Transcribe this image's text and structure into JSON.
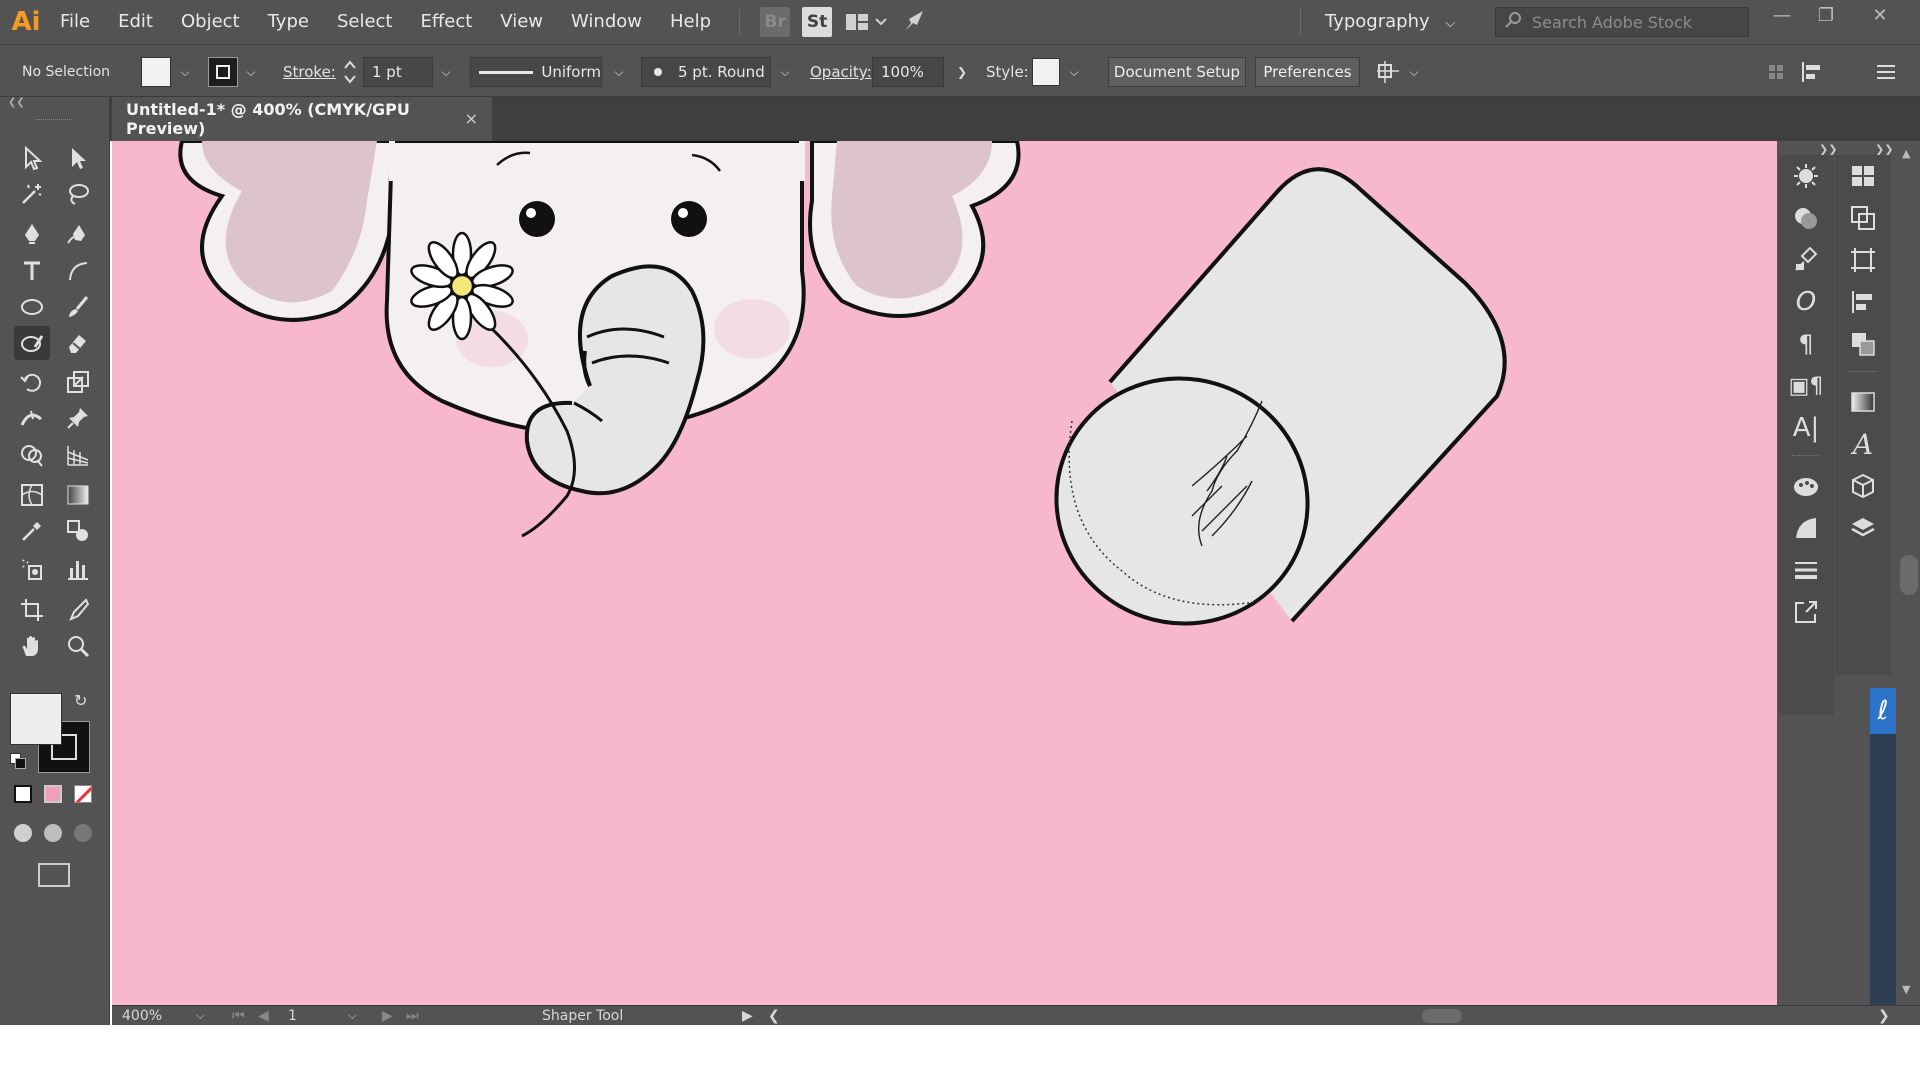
{
  "app": {
    "logo": "Ai",
    "menu": [
      "File",
      "Edit",
      "Object",
      "Type",
      "Select",
      "Effect",
      "View",
      "Window",
      "Help"
    ],
    "bridge_label": "Br",
    "stock_label": "St",
    "workspace": "Typography",
    "search_placeholder": "Search Adobe Stock"
  },
  "control_bar": {
    "selection": "No Selection",
    "stroke_label": "Stroke:",
    "stroke_weight": "1 pt",
    "profile": "Uniform",
    "brush": "5 pt. Round",
    "opacity_label": "Opacity:",
    "opacity": "100%",
    "style_label": "Style:",
    "document_setup": "Document Setup",
    "preferences": "Preferences"
  },
  "document": {
    "tab_title": "Untitled-1* @ 400% (CMYK/GPU Preview)",
    "close_glyph": "×"
  },
  "status": {
    "zoom": "400%",
    "artboard": "1",
    "tool_name": "Shaper Tool"
  },
  "tools": [
    {
      "name": "selection-tool",
      "icon": "arrow"
    },
    {
      "name": "direct-selection-tool",
      "icon": "white-arrow"
    },
    {
      "name": "magic-wand-tool",
      "icon": "wand"
    },
    {
      "name": "lasso-tool",
      "icon": "lasso"
    },
    {
      "name": "pen-tool",
      "icon": "pen"
    },
    {
      "name": "curvature-tool",
      "icon": "curvature"
    },
    {
      "name": "type-tool",
      "icon": "T"
    },
    {
      "name": "line-segment-tool",
      "icon": "arc"
    },
    {
      "name": "ellipse-tool",
      "icon": "ellipse"
    },
    {
      "name": "paintbrush-tool",
      "icon": "brush"
    },
    {
      "name": "shaper-tool",
      "icon": "shaper"
    },
    {
      "name": "eraser-tool",
      "icon": "eraser"
    },
    {
      "name": "rotate-tool",
      "icon": "rotate"
    },
    {
      "name": "scale-tool",
      "icon": "scale"
    },
    {
      "name": "width-tool",
      "icon": "width"
    },
    {
      "name": "puppet-warp-tool",
      "icon": "pin"
    },
    {
      "name": "shape-builder-tool",
      "icon": "shape-builder"
    },
    {
      "name": "perspective-grid-tool",
      "icon": "perspective"
    },
    {
      "name": "mesh-tool",
      "icon": "mesh"
    },
    {
      "name": "gradient-tool",
      "icon": "gradient"
    },
    {
      "name": "eyedropper-tool",
      "icon": "eyedropper"
    },
    {
      "name": "blend-tool",
      "icon": "blend"
    },
    {
      "name": "symbol-sprayer-tool",
      "icon": "symbol"
    },
    {
      "name": "column-graph-tool",
      "icon": "graph"
    },
    {
      "name": "artboard-tool",
      "icon": "artboard"
    },
    {
      "name": "slice-tool",
      "icon": "knife"
    },
    {
      "name": "hand-tool",
      "icon": "hand"
    },
    {
      "name": "zoom-tool",
      "icon": "zoom"
    }
  ],
  "colors": {
    "canvas": "#f7b8cd",
    "ui_bg": "#535353",
    "accent": "#2c74c9"
  }
}
